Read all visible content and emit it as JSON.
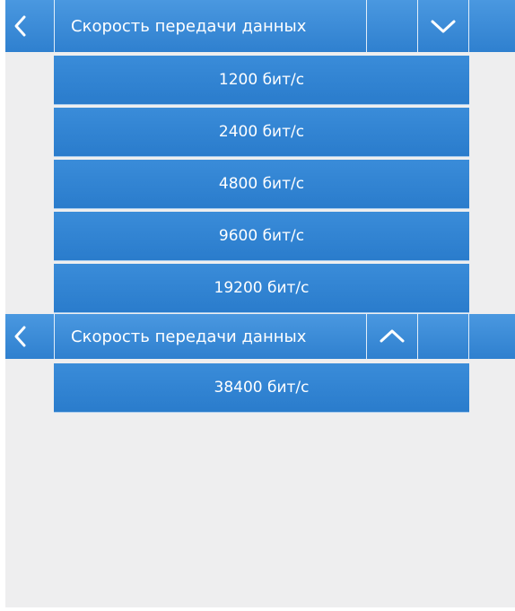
{
  "screens": [
    {
      "header": {
        "title": "Скорость передачи данных",
        "back_icon": "chevron-left-icon",
        "scroll_icon": "chevron-down-icon"
      },
      "items": [
        "1200 бит/с",
        "2400 бит/с",
        "4800 бит/с",
        "9600 бит/с",
        "19200 бит/с"
      ]
    },
    {
      "header": {
        "title": "Скорость передачи данных",
        "back_icon": "chevron-left-icon",
        "scroll_icon": "chevron-up-icon"
      },
      "items": [
        "38400 бит/с"
      ]
    }
  ],
  "colors": {
    "accent": "#2f82d2",
    "background": "#eeeeef",
    "text_on_accent": "#ffffff"
  }
}
